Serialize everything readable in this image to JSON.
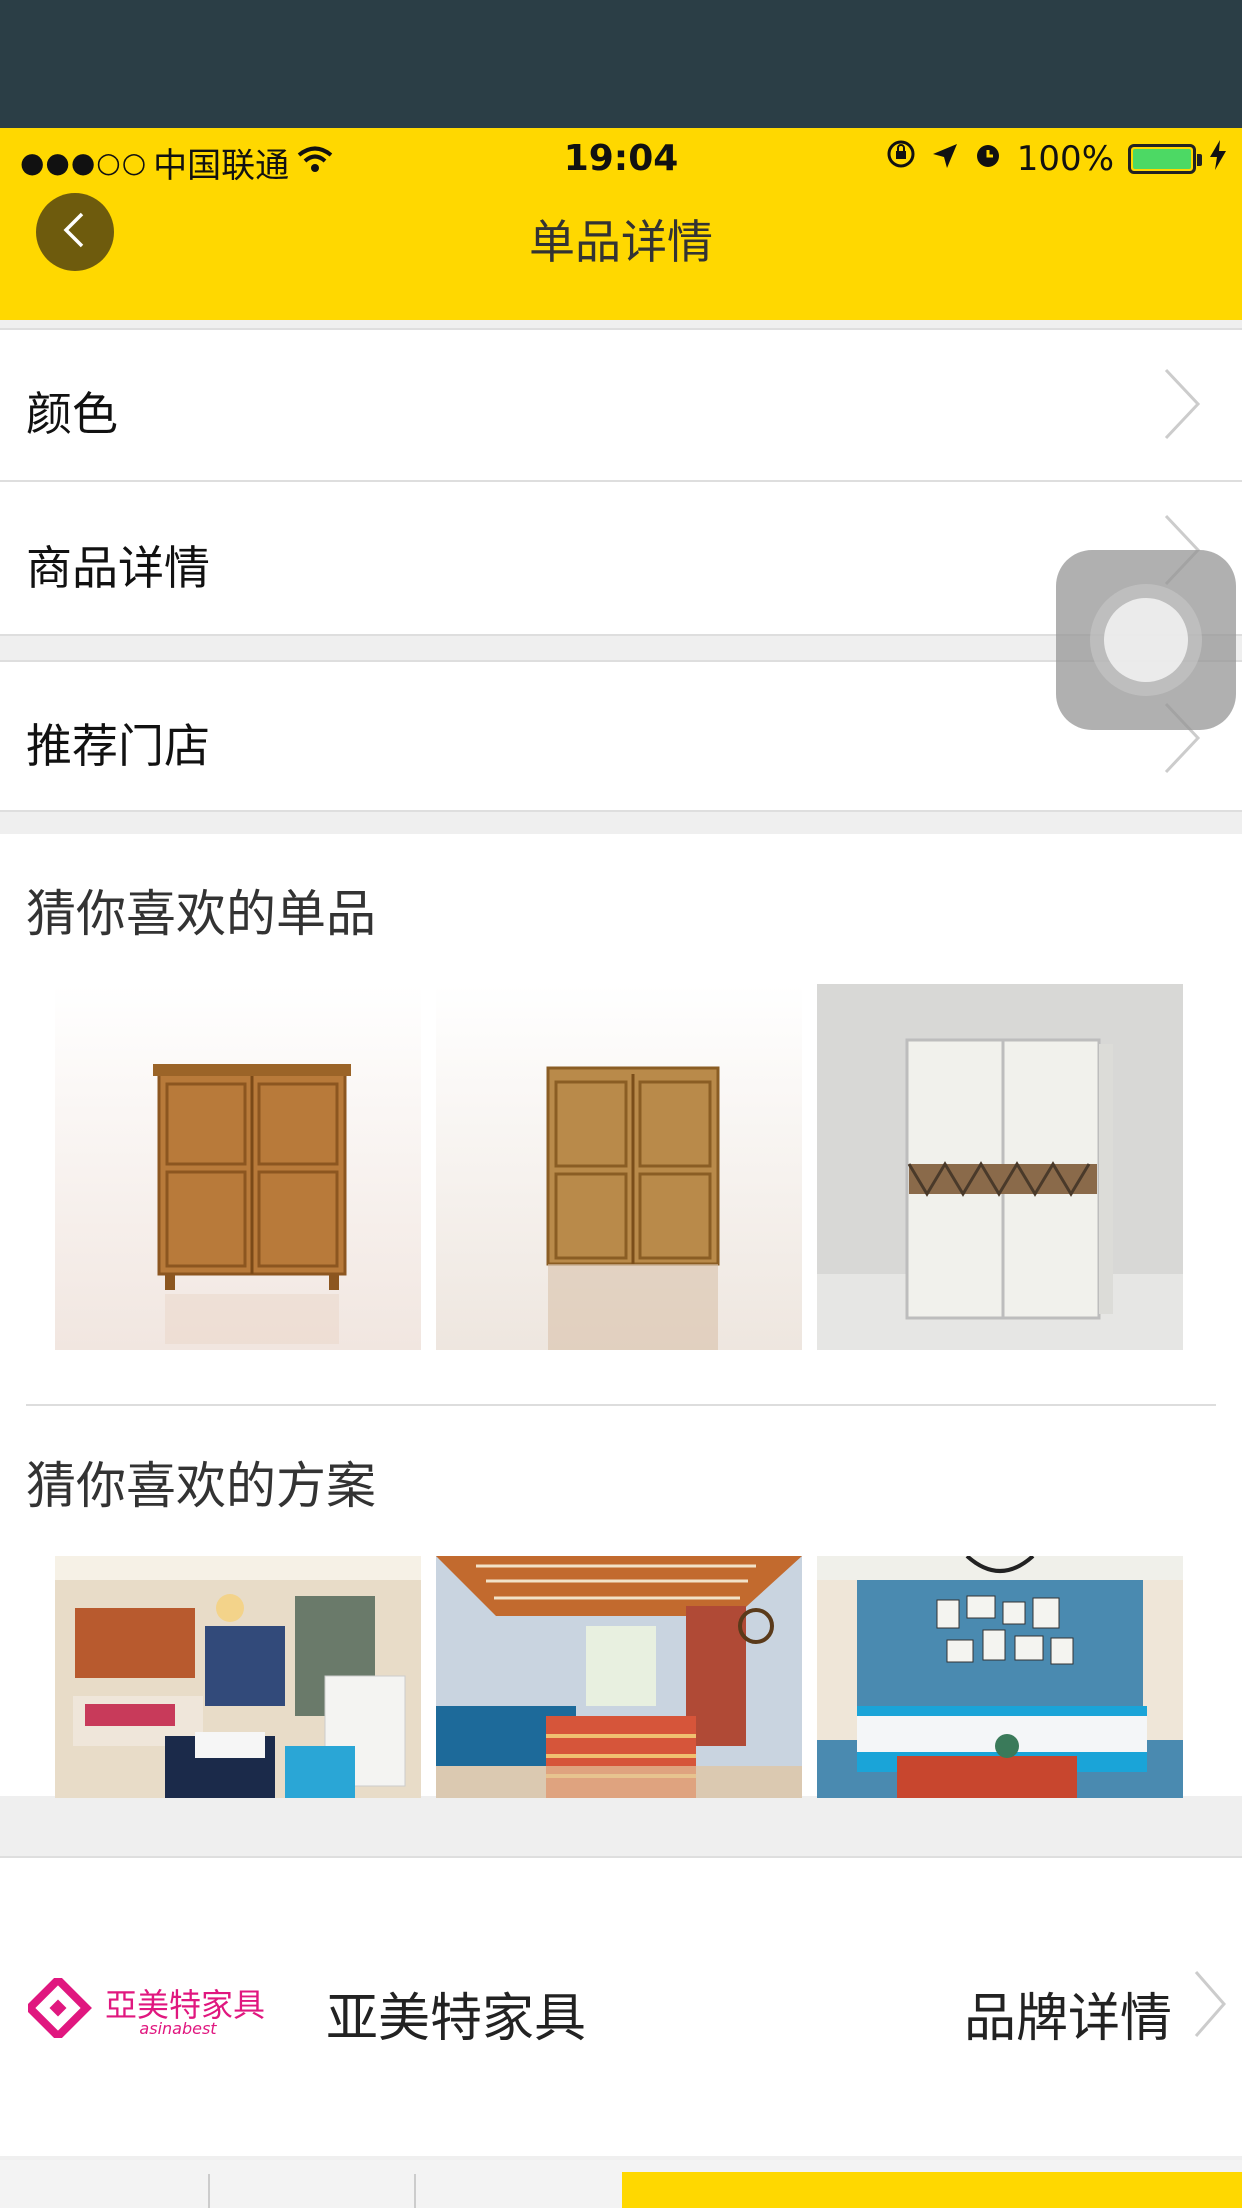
{
  "status_bar": {
    "signal": "●●●○○",
    "carrier": "中国联通",
    "time": "19:04",
    "battery_percent_text": "100%",
    "battery_level": 1.0
  },
  "nav": {
    "title": "单品详情"
  },
  "rows": {
    "color": "颜色",
    "product_detail": "商品详情",
    "recommended_store": "推荐门店"
  },
  "liked_items": {
    "title": "猜你喜欢的单品"
  },
  "liked_plans": {
    "title": "猜你喜欢的方案"
  },
  "brand": {
    "logo_text": "亞美特家具",
    "logo_subtext": "asinabest",
    "name": "亚美特家具",
    "link_label": "品牌详情",
    "accent_color": "#e0177f"
  },
  "colors": {
    "primary_yellow": "#ffd800",
    "header_dark": "#2b3e46"
  }
}
